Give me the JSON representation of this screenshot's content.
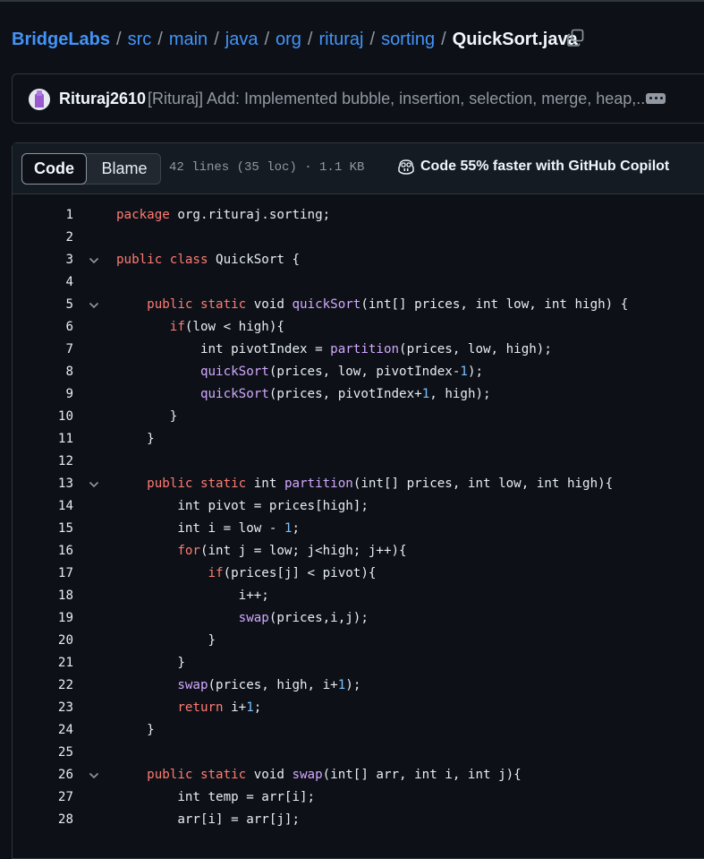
{
  "breadcrumb": {
    "repo": "BridgeLabs",
    "parts": [
      "src",
      "main",
      "java",
      "org",
      "rituraj",
      "sorting"
    ],
    "file": "QuickSort.java",
    "separator": "/"
  },
  "commit": {
    "author": "Rituraj2610",
    "message": "[Rituraj] Add: Implemented bubble, insertion, selection, merge, heap,..."
  },
  "file_header": {
    "tab_code": "Code",
    "tab_blame": "Blame",
    "info": "42 lines (35 loc) · 1.1 KB",
    "copilot": "Code 55% faster with GitHub Copilot"
  },
  "code_lines": [
    {
      "n": "1",
      "fold": false,
      "tokens": [
        [
          "k",
          "package"
        ],
        [
          "p",
          " org.rituraj.sorting;"
        ]
      ]
    },
    {
      "n": "2",
      "fold": false,
      "tokens": []
    },
    {
      "n": "3",
      "fold": true,
      "tokens": [
        [
          "k",
          "public"
        ],
        [
          "p",
          " "
        ],
        [
          "k",
          "class"
        ],
        [
          "p",
          " QuickSort {"
        ]
      ]
    },
    {
      "n": "4",
      "fold": false,
      "tokens": []
    },
    {
      "n": "5",
      "fold": true,
      "tokens": [
        [
          "p",
          "    "
        ],
        [
          "k",
          "public"
        ],
        [
          "p",
          " "
        ],
        [
          "k",
          "static"
        ],
        [
          "p",
          " void "
        ],
        [
          "f",
          "quickSort"
        ],
        [
          "p",
          "(int[] prices, int low, int high) {"
        ]
      ]
    },
    {
      "n": "6",
      "fold": false,
      "tokens": [
        [
          "p",
          "       "
        ],
        [
          "k",
          "if"
        ],
        [
          "p",
          "(low < high){"
        ]
      ]
    },
    {
      "n": "7",
      "fold": false,
      "tokens": [
        [
          "p",
          "           int pivotIndex = "
        ],
        [
          "f",
          "partition"
        ],
        [
          "p",
          "(prices, low, high);"
        ]
      ]
    },
    {
      "n": "8",
      "fold": false,
      "tokens": [
        [
          "p",
          "           "
        ],
        [
          "f",
          "quickSort"
        ],
        [
          "p",
          "(prices, low, pivotIndex-"
        ],
        [
          "n",
          "1"
        ],
        [
          "p",
          ");"
        ]
      ]
    },
    {
      "n": "9",
      "fold": false,
      "tokens": [
        [
          "p",
          "           "
        ],
        [
          "f",
          "quickSort"
        ],
        [
          "p",
          "(prices, pivotIndex+"
        ],
        [
          "n",
          "1"
        ],
        [
          "p",
          ", high);"
        ]
      ]
    },
    {
      "n": "10",
      "fold": false,
      "tokens": [
        [
          "p",
          "       }"
        ]
      ]
    },
    {
      "n": "11",
      "fold": false,
      "tokens": [
        [
          "p",
          "    }"
        ]
      ]
    },
    {
      "n": "12",
      "fold": false,
      "tokens": []
    },
    {
      "n": "13",
      "fold": true,
      "tokens": [
        [
          "p",
          "    "
        ],
        [
          "k",
          "public"
        ],
        [
          "p",
          " "
        ],
        [
          "k",
          "static"
        ],
        [
          "p",
          " int "
        ],
        [
          "f",
          "partition"
        ],
        [
          "p",
          "(int[] prices, int low, int high){"
        ]
      ]
    },
    {
      "n": "14",
      "fold": false,
      "tokens": [
        [
          "p",
          "        int pivot = prices[high];"
        ]
      ]
    },
    {
      "n": "15",
      "fold": false,
      "tokens": [
        [
          "p",
          "        int i = low - "
        ],
        [
          "n",
          "1"
        ],
        [
          "p",
          ";"
        ]
      ]
    },
    {
      "n": "16",
      "fold": false,
      "tokens": [
        [
          "p",
          "        "
        ],
        [
          "k",
          "for"
        ],
        [
          "p",
          "(int j = low; j<high; j++){"
        ]
      ]
    },
    {
      "n": "17",
      "fold": false,
      "tokens": [
        [
          "p",
          "            "
        ],
        [
          "k",
          "if"
        ],
        [
          "p",
          "(prices[j] < pivot){"
        ]
      ]
    },
    {
      "n": "18",
      "fold": false,
      "tokens": [
        [
          "p",
          "                i++;"
        ]
      ]
    },
    {
      "n": "19",
      "fold": false,
      "tokens": [
        [
          "p",
          "                "
        ],
        [
          "f",
          "swap"
        ],
        [
          "p",
          "(prices,i,j);"
        ]
      ]
    },
    {
      "n": "20",
      "fold": false,
      "tokens": [
        [
          "p",
          "            }"
        ]
      ]
    },
    {
      "n": "21",
      "fold": false,
      "tokens": [
        [
          "p",
          "        }"
        ]
      ]
    },
    {
      "n": "22",
      "fold": false,
      "tokens": [
        [
          "p",
          "        "
        ],
        [
          "f",
          "swap"
        ],
        [
          "p",
          "(prices, high, i+"
        ],
        [
          "n",
          "1"
        ],
        [
          "p",
          ");"
        ]
      ]
    },
    {
      "n": "23",
      "fold": false,
      "tokens": [
        [
          "p",
          "        "
        ],
        [
          "k",
          "return"
        ],
        [
          "p",
          " i+"
        ],
        [
          "n",
          "1"
        ],
        [
          "p",
          ";"
        ]
      ]
    },
    {
      "n": "24",
      "fold": false,
      "tokens": [
        [
          "p",
          "    }"
        ]
      ]
    },
    {
      "n": "25",
      "fold": false,
      "tokens": []
    },
    {
      "n": "26",
      "fold": true,
      "tokens": [
        [
          "p",
          "    "
        ],
        [
          "k",
          "public"
        ],
        [
          "p",
          " "
        ],
        [
          "k",
          "static"
        ],
        [
          "p",
          " void "
        ],
        [
          "f",
          "swap"
        ],
        [
          "p",
          "(int[] arr, int i, int j){"
        ]
      ]
    },
    {
      "n": "27",
      "fold": false,
      "tokens": [
        [
          "p",
          "        int temp = arr[i];"
        ]
      ]
    },
    {
      "n": "28",
      "fold": false,
      "tokens": [
        [
          "p",
          "        arr[i] = arr[j];"
        ]
      ]
    }
  ],
  "icons": {
    "copy": "copy-path-icon",
    "kebab": "kebab-horizontal-icon",
    "copilot": "copilot-icon",
    "fold": "chevron-down-icon"
  },
  "colors": {
    "background": "#0d1117",
    "link": "#4493f8",
    "keyword": "#ff7b72",
    "function": "#d2a8ff",
    "number": "#79c0ff"
  }
}
